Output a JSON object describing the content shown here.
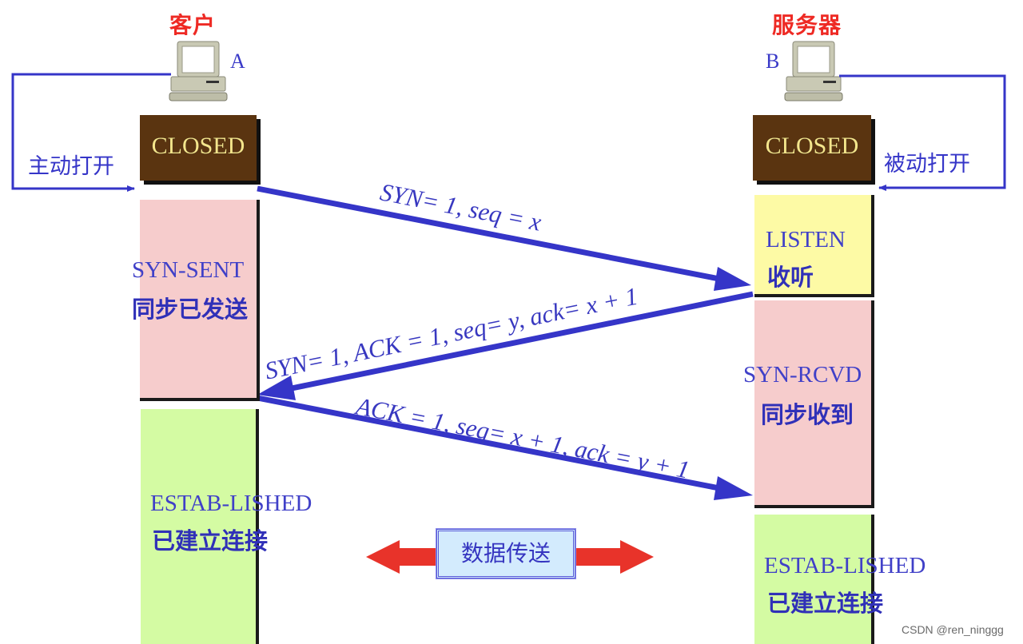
{
  "client": {
    "title": "客户",
    "host_label": "A",
    "open_label": "主动打开",
    "states": [
      {
        "en": "CLOSED",
        "zh": ""
      },
      {
        "en": "SYN-SENT",
        "zh": "同步已发送"
      },
      {
        "en": "ESTAB-LISHED",
        "zh": "已建立连接"
      }
    ]
  },
  "server": {
    "title": "服务器",
    "host_label": "B",
    "open_label": "被动打开",
    "states": [
      {
        "en": "CLOSED",
        "zh": ""
      },
      {
        "en": "LISTEN",
        "zh": "收听"
      },
      {
        "en": "SYN-RCVD",
        "zh": "同步收到"
      },
      {
        "en": "ESTAB-LISHED",
        "zh": "已建立连接"
      }
    ]
  },
  "messages": [
    {
      "direction": "A→B",
      "label": "SYN= 1, seq = x"
    },
    {
      "direction": "B→A",
      "label": "SYN= 1, ACK = 1, seq= y, ack= x + 1"
    },
    {
      "direction": "A→B",
      "label": "ACK = 1, seq= x + 1, ack = y + 1"
    }
  ],
  "data_transfer": {
    "label": "数据传送"
  },
  "colors": {
    "title_red": "#ee2a24",
    "arrow_blue": "#3535c8",
    "closed_brown": "#5a3410",
    "pink": "#f6cccc",
    "yellow": "#fdfaa5",
    "green": "#d4fba3",
    "data_arrow_red": "#e8332a"
  },
  "watermark": "CSDN @ren_ninggg"
}
